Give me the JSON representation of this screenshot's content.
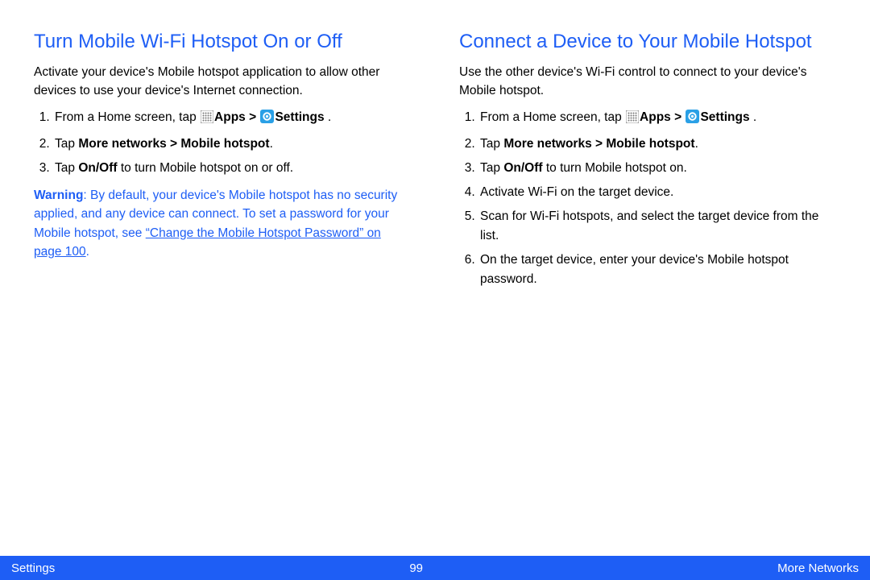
{
  "left": {
    "heading": "Turn Mobile Wi-Fi Hotspot On or Off",
    "intro": "Activate your device's Mobile hotspot application to allow other devices to use your device's Internet connection.",
    "step1_pre": "From a Home screen, tap ",
    "step1_apps": "Apps > ",
    "step1_settings": "Settings",
    "step1_post": " .",
    "step2_pre": "Tap ",
    "step2_bold": "More networks > Mobile hotspot",
    "step2_post": ".",
    "step3_pre": "Tap ",
    "step3_bold": "On/Off",
    "step3_post": " to turn Mobile hotspot on or off.",
    "warn_label": "Warning",
    "warn_body1": ": By default, your device's Mobile hotspot has no security applied, and any device can connect. To set a password for your Mobile hotspot, see ",
    "warn_link": "“Change the Mobile Hotspot Password” on page 100",
    "warn_body2": "."
  },
  "right": {
    "heading": "Connect a Device to Your Mobile Hotspot",
    "intro": "Use the other device's Wi-Fi control to connect to your device's Mobile hotspot.",
    "step1_pre": "From a Home screen, tap ",
    "step1_apps": "Apps > ",
    "step1_settings": "Settings",
    "step1_post": " .",
    "step2_pre": "Tap ",
    "step2_bold": "More networks > Mobile hotspot",
    "step2_post": ".",
    "step3_pre": "Tap ",
    "step3_bold": "On/Off",
    "step3_post": " to turn Mobile hotspot on.",
    "step4": "Activate Wi-Fi on the target device.",
    "step5": "Scan for Wi-Fi hotspots, and select the target device from the list.",
    "step6": "On the target device, enter your device's Mobile hotspot password."
  },
  "footer": {
    "left": "Settings",
    "center": "99",
    "right": "More Networks"
  }
}
